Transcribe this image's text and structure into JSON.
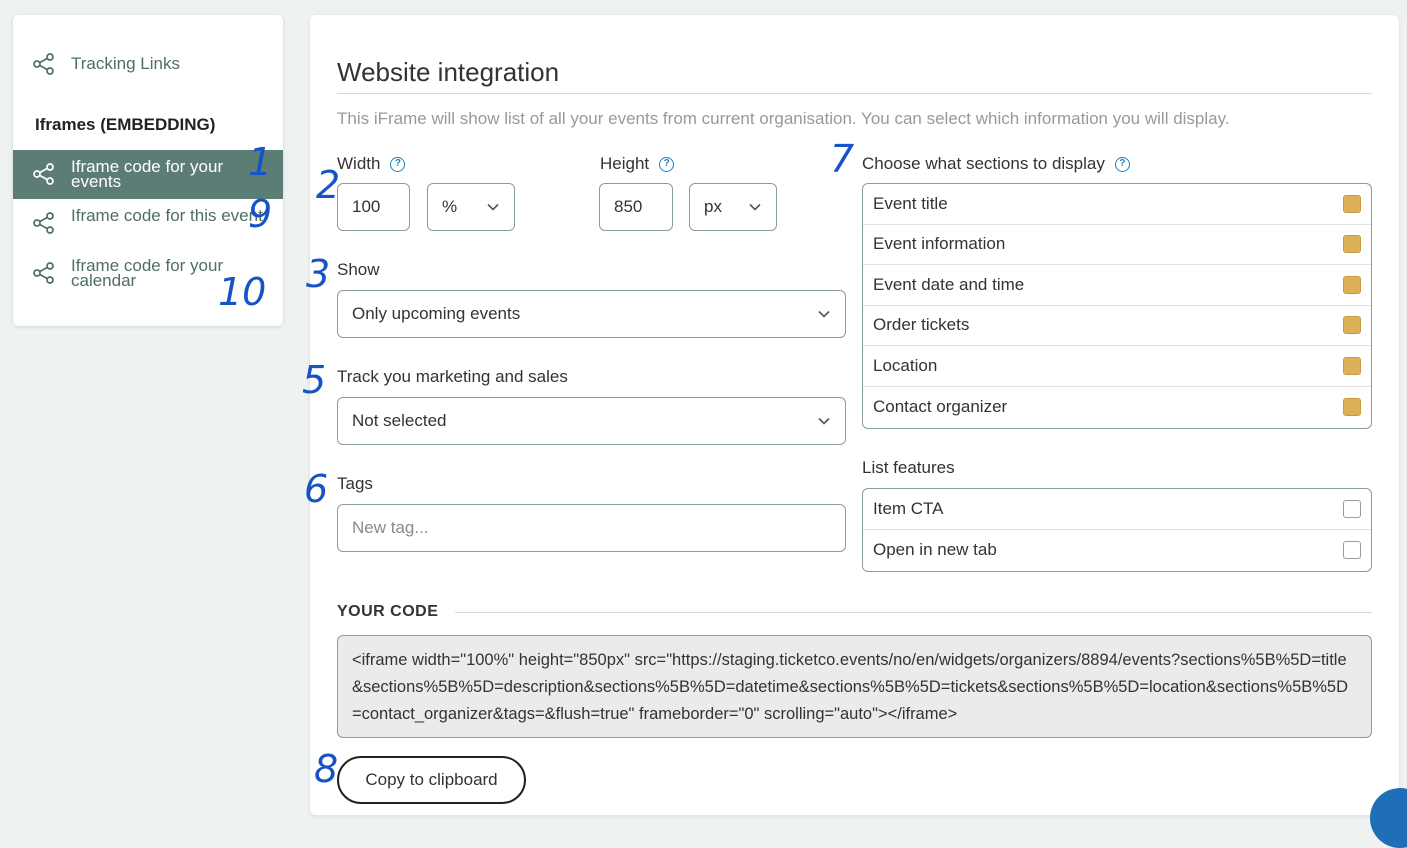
{
  "sidebar": {
    "tracking_links": "Tracking Links",
    "section_title": "Iframes (EMBEDDING)",
    "items": [
      {
        "label": "Iframe code for your events",
        "active": true
      },
      {
        "label": "Iframe code for this event",
        "active": false
      },
      {
        "label": "Iframe code for your calendar",
        "active": false
      }
    ]
  },
  "main": {
    "title": "Website integration",
    "description": "This iFrame will show list of all your events from current organisation. You can select which information you will display.",
    "width": {
      "label": "Width",
      "value": "100",
      "unit": "%"
    },
    "height": {
      "label": "Height",
      "value": "850",
      "unit": "px"
    },
    "show": {
      "label": "Show",
      "value": "Only upcoming events"
    },
    "track": {
      "label": "Track you marketing and sales",
      "value": "Not selected"
    },
    "tags": {
      "label": "Tags",
      "placeholder": "New tag..."
    },
    "sections": {
      "label": "Choose what sections to display",
      "items": [
        {
          "label": "Event title",
          "checked": true
        },
        {
          "label": "Event information",
          "checked": true
        },
        {
          "label": "Event date and time",
          "checked": true
        },
        {
          "label": "Order tickets",
          "checked": true
        },
        {
          "label": "Location",
          "checked": true
        },
        {
          "label": "Contact organizer",
          "checked": true
        }
      ]
    },
    "features": {
      "label": "List features",
      "items": [
        {
          "label": "Item CTA",
          "checked": false
        },
        {
          "label": "Open in new tab",
          "checked": false
        }
      ]
    },
    "code_title": "YOUR CODE",
    "code": "<iframe width=\"100%\" height=\"850px\" src=\"https://staging.ticketco.events/no/en/widgets/organizers/8894/events?sections%5B%5D=title&sections%5B%5D=description&sections%5B%5D=datetime&sections%5B%5D=tickets&sections%5B%5D=location&sections%5B%5D=contact_organizer&tags=&flush=true\" frameborder=\"0\" scrolling=\"auto\"></iframe>",
    "copy_button": "Copy to clipboard"
  },
  "annotations": [
    "1",
    "2",
    "3",
    "5",
    "6",
    "7",
    "8",
    "9",
    "10"
  ],
  "colors": {
    "active": "#5c7d76",
    "checkbox": "#ddb15a",
    "link": "#4e6e66",
    "help": "#1e7fc6",
    "annotation": "#1653c4"
  },
  "icons": {
    "share": "share-icon",
    "help": "help-circle-icon",
    "chevron": "chevron-down-icon"
  }
}
